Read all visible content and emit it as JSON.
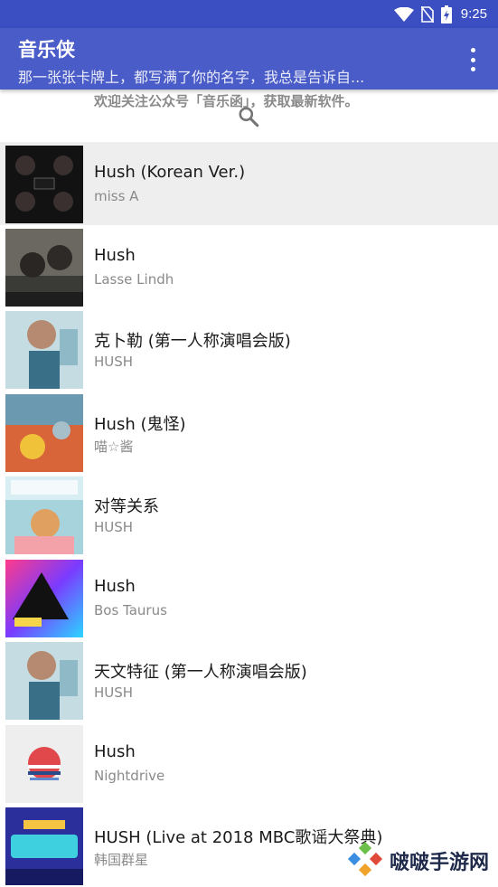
{
  "status_bar": {
    "time": "9:25",
    "icons": [
      "wifi-icon",
      "no-sim-icon",
      "battery-charging-icon"
    ]
  },
  "app_bar": {
    "title": "音乐侠",
    "subtitle": "那一张张卡牌上，都写满了你的名字，我总是告诉自...",
    "menu_icon": "more-vertical-icon"
  },
  "notice": {
    "text": "欢迎关注公众号「音乐函」，获取最新软件。",
    "icon": "search-icon"
  },
  "songs": [
    {
      "title": "Hush (Korean Ver.)",
      "artist": "miss A"
    },
    {
      "title": "Hush",
      "artist": "Lasse Lindh"
    },
    {
      "title": "克卜勒 (第一人称演唱会版)",
      "artist": "HUSH"
    },
    {
      "title": "Hush (鬼怪)",
      "artist": "喵☆酱"
    },
    {
      "title": "对等关系",
      "artist": "HUSH"
    },
    {
      "title": "Hush",
      "artist": "Bos Taurus"
    },
    {
      "title": "天文特征 (第一人称演唱会版)",
      "artist": "HUSH"
    },
    {
      "title": "Hush",
      "artist": "Nightdrive"
    },
    {
      "title": "HUSH (Live at 2018 MBC歌谣大祭典)",
      "artist": "韩国群星"
    }
  ],
  "watermark": {
    "text": "啵啵手游网",
    "icon": "watermark-logo-icon"
  },
  "colors": {
    "status_bar": "#3b4ec2",
    "app_bar": "#4a5cc8",
    "selected_row": "#eeeeee",
    "secondary_text": "#8a8a8a"
  }
}
